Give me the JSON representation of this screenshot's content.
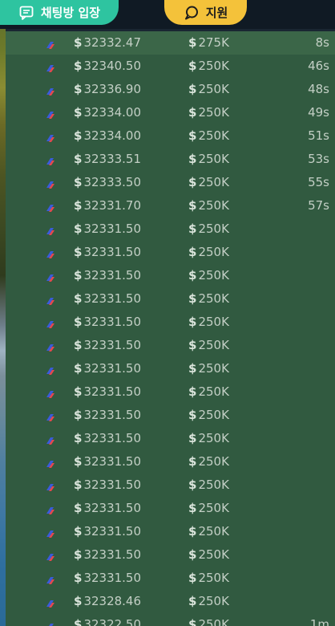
{
  "header": {
    "chat_button_label": "채팅방 입장",
    "support_button_label": "지원"
  },
  "colors": {
    "chat_button": "#2ec4a0",
    "support_button": "#f4c23a",
    "list_background": "#315a40",
    "exchange_icon_blue": "#3b5bdb",
    "exchange_icon_red": "#e5484d"
  },
  "trades": {
    "currency_symbol": "$",
    "rows": [
      {
        "price": "32332.47",
        "amount": "275K",
        "time": "8s"
      },
      {
        "price": "32340.50",
        "amount": "250K",
        "time": "46s"
      },
      {
        "price": "32336.90",
        "amount": "250K",
        "time": "48s"
      },
      {
        "price": "32334.00",
        "amount": "250K",
        "time": "49s"
      },
      {
        "price": "32334.00",
        "amount": "250K",
        "time": "51s"
      },
      {
        "price": "32333.51",
        "amount": "250K",
        "time": "53s"
      },
      {
        "price": "32333.50",
        "amount": "250K",
        "time": "55s"
      },
      {
        "price": "32331.70",
        "amount": "250K",
        "time": "57s"
      },
      {
        "price": "32331.50",
        "amount": "250K",
        "time": ""
      },
      {
        "price": "32331.50",
        "amount": "250K",
        "time": ""
      },
      {
        "price": "32331.50",
        "amount": "250K",
        "time": ""
      },
      {
        "price": "32331.50",
        "amount": "250K",
        "time": ""
      },
      {
        "price": "32331.50",
        "amount": "250K",
        "time": ""
      },
      {
        "price": "32331.50",
        "amount": "250K",
        "time": ""
      },
      {
        "price": "32331.50",
        "amount": "250K",
        "time": ""
      },
      {
        "price": "32331.50",
        "amount": "250K",
        "time": ""
      },
      {
        "price": "32331.50",
        "amount": "250K",
        "time": ""
      },
      {
        "price": "32331.50",
        "amount": "250K",
        "time": ""
      },
      {
        "price": "32331.50",
        "amount": "250K",
        "time": ""
      },
      {
        "price": "32331.50",
        "amount": "250K",
        "time": ""
      },
      {
        "price": "32331.50",
        "amount": "250K",
        "time": ""
      },
      {
        "price": "32331.50",
        "amount": "250K",
        "time": ""
      },
      {
        "price": "32331.50",
        "amount": "250K",
        "time": ""
      },
      {
        "price": "32331.50",
        "amount": "250K",
        "time": ""
      },
      {
        "price": "32328.46",
        "amount": "250K",
        "time": ""
      },
      {
        "price": "32322.50",
        "amount": "250K",
        "time": "1m"
      }
    ]
  }
}
